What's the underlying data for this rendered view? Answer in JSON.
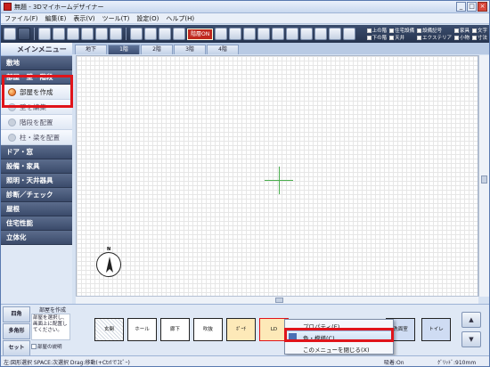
{
  "window": {
    "title": "無題 - 3Dマイホームデザイナー",
    "controls": [
      "_",
      "□",
      "×"
    ]
  },
  "menubar": {
    "items": [
      "ファイル(F)",
      "編集(E)",
      "表示(V)",
      "ツール(T)",
      "設定(O)",
      "ヘルプ(H)"
    ]
  },
  "toolbar": {
    "floor_toggle": "階層ON",
    "checkboxes": [
      "上の階",
      "住宅設備",
      "設備記号",
      "家具",
      "文字",
      "下の階",
      "天井",
      "エクステリア",
      "小物",
      "寸法"
    ]
  },
  "sidebar": {
    "header": "メインメニュー",
    "items": [
      {
        "label": "敷地",
        "kind": "cat"
      },
      {
        "label": "部屋・壁・階段",
        "kind": "cat"
      },
      {
        "label": "部屋を作成",
        "kind": "sub"
      },
      {
        "label": "壁を編集",
        "kind": "sub"
      },
      {
        "label": "階段を配置",
        "kind": "sub"
      },
      {
        "label": "柱・梁を配置",
        "kind": "sub"
      },
      {
        "label": "ドア・窓",
        "kind": "cat"
      },
      {
        "label": "設備・家具",
        "kind": "cat"
      },
      {
        "label": "照明・天井器具",
        "kind": "cat"
      },
      {
        "label": "診断／チェック",
        "kind": "cat"
      },
      {
        "label": "屋根",
        "kind": "cat"
      },
      {
        "label": "住宅性能",
        "kind": "cat"
      },
      {
        "label": "立体化",
        "kind": "cat"
      }
    ]
  },
  "floor_tabs": [
    "地下",
    "1階",
    "2階",
    "3階",
    "4階"
  ],
  "bottom_left": {
    "tabs": [
      "四角",
      "多角形",
      "セット"
    ],
    "title": "部屋を作成",
    "description": "部屋を選択し、画面上に配置してください。",
    "checkbox": "部屋の説明"
  },
  "palette": {
    "items": [
      "玄関",
      "ホール",
      "廊下",
      "吹抜",
      "ﾎﾟｰﾁ",
      "LD",
      "洗面室",
      "トイレ"
    ]
  },
  "context_menu": {
    "items": [
      "プロパティ(E)...",
      "色・模様(C)...",
      "このメニューを閉じる(X)"
    ]
  },
  "statusbar": {
    "left": "左:図形選択 SPACE:次選択 Drag:移動(+Ctrlでｺﾋﾟｰ)",
    "snap": "吸着:On",
    "grid": "ｸﾞﾘｯﾄﾞ:910mm"
  },
  "compass_label": "N"
}
